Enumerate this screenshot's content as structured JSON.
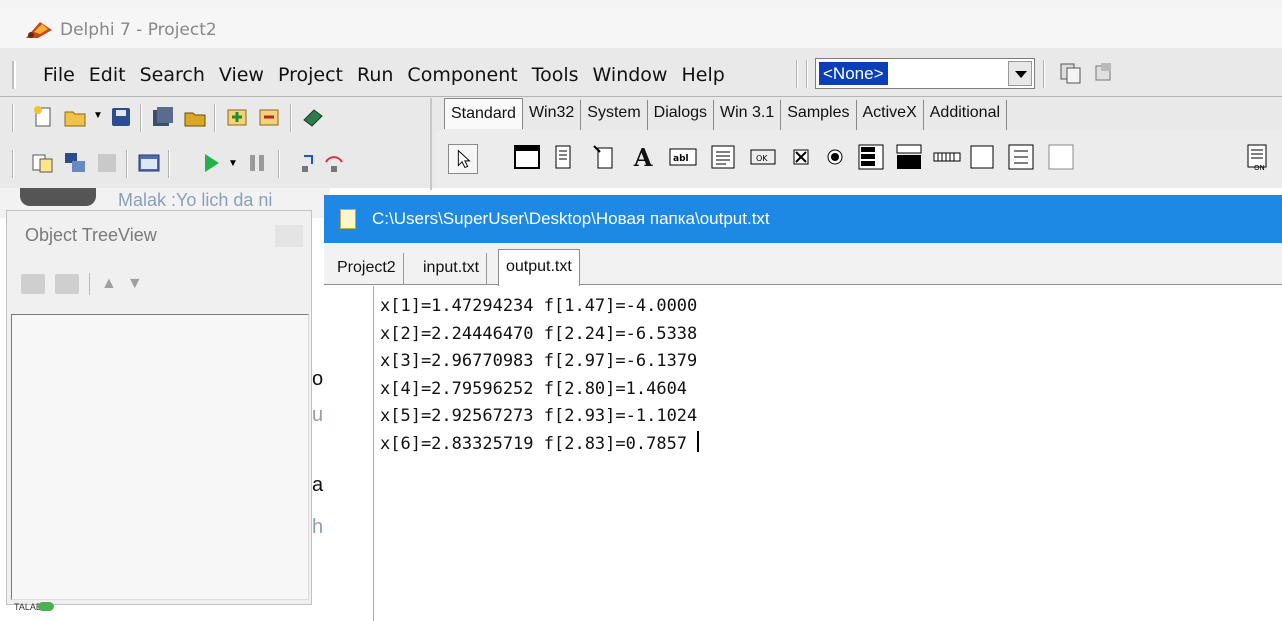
{
  "app": {
    "title": "Delphi 7 - Project2"
  },
  "menu": [
    "File",
    "Edit",
    "Search",
    "View",
    "Project",
    "Run",
    "Component",
    "Tools",
    "Window",
    "Help"
  ],
  "form_combo": {
    "value": "<None>"
  },
  "palette_tabs": [
    "Standard",
    "Win32",
    "System",
    "Dialogs",
    "Win 3.1",
    "Samples",
    "ActiveX",
    "Additional"
  ],
  "palette_active": "Standard",
  "background_window": {
    "text": "Malak :Yo lich da ni"
  },
  "object_treeview": {
    "title": "Object TreeView"
  },
  "editor": {
    "path": "C:\\Users\\SuperUser\\Desktop\\Новая папка\\output.txt",
    "tabs": [
      "Project2",
      "input.txt",
      "output.txt"
    ],
    "active_tab": "output.txt",
    "lines": [
      "x[1]=1.47294234 f[1.47]=-4.0000",
      "x[2]=2.24446470 f[2.24]=-6.5338",
      "x[3]=2.96770983 f[2.97]=-6.1379",
      "x[4]=2.79596252 f[2.80]=1.4604",
      "x[5]=2.92567273 f[2.93]=-1.1024",
      "x[6]=2.83325719 f[2.83]=0.7857 "
    ]
  },
  "status": {
    "tag": "TALABA"
  },
  "colors": {
    "accent": "#1e88e5",
    "selection": "#0a3fb8"
  }
}
